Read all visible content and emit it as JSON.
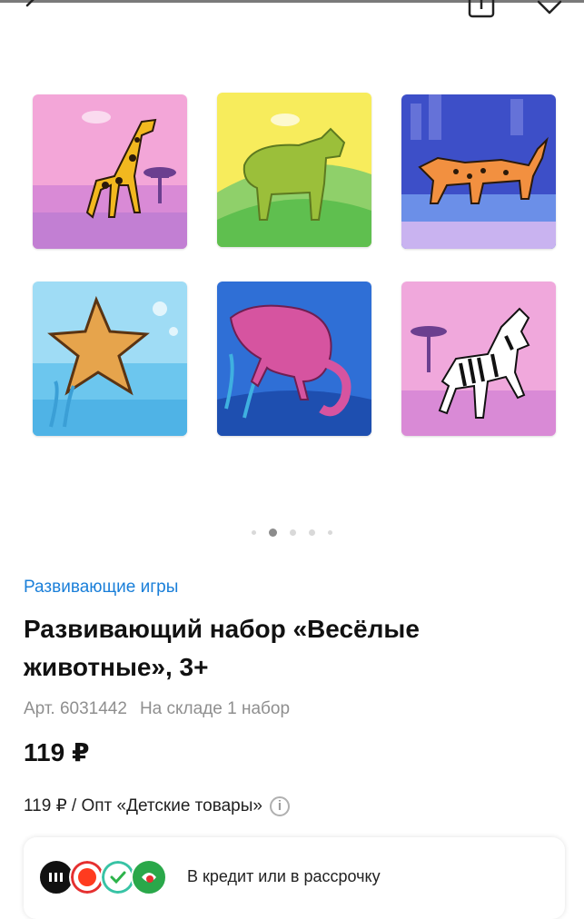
{
  "header": {
    "back_icon": "chevron-left-icon",
    "share_icon": "share-icon",
    "favorite_icon": "heart-icon"
  },
  "gallery": {
    "images": [
      {
        "animal": "giraffe"
      },
      {
        "animal": "cow"
      },
      {
        "animal": "leopard"
      },
      {
        "animal": "starfish"
      },
      {
        "animal": "chameleon"
      },
      {
        "animal": "zebra"
      }
    ],
    "dots_total": 5,
    "active_dot": 2
  },
  "product": {
    "category": "Развивающие игры",
    "title": "Развивающий набор «Весёлые животные», 3+",
    "article": "Арт. 6031442",
    "stock": "На складе 1 набор",
    "price": "119 ₽",
    "wholesale": "119 ₽ / Опт «Детские товары»",
    "info_icon": "ⓘ"
  },
  "credit": {
    "label": "В кредит или в рассрочку",
    "bank_icons": [
      "bank-black-icon",
      "bank-red-icon",
      "bank-check-icon",
      "bank-green-icon"
    ]
  }
}
